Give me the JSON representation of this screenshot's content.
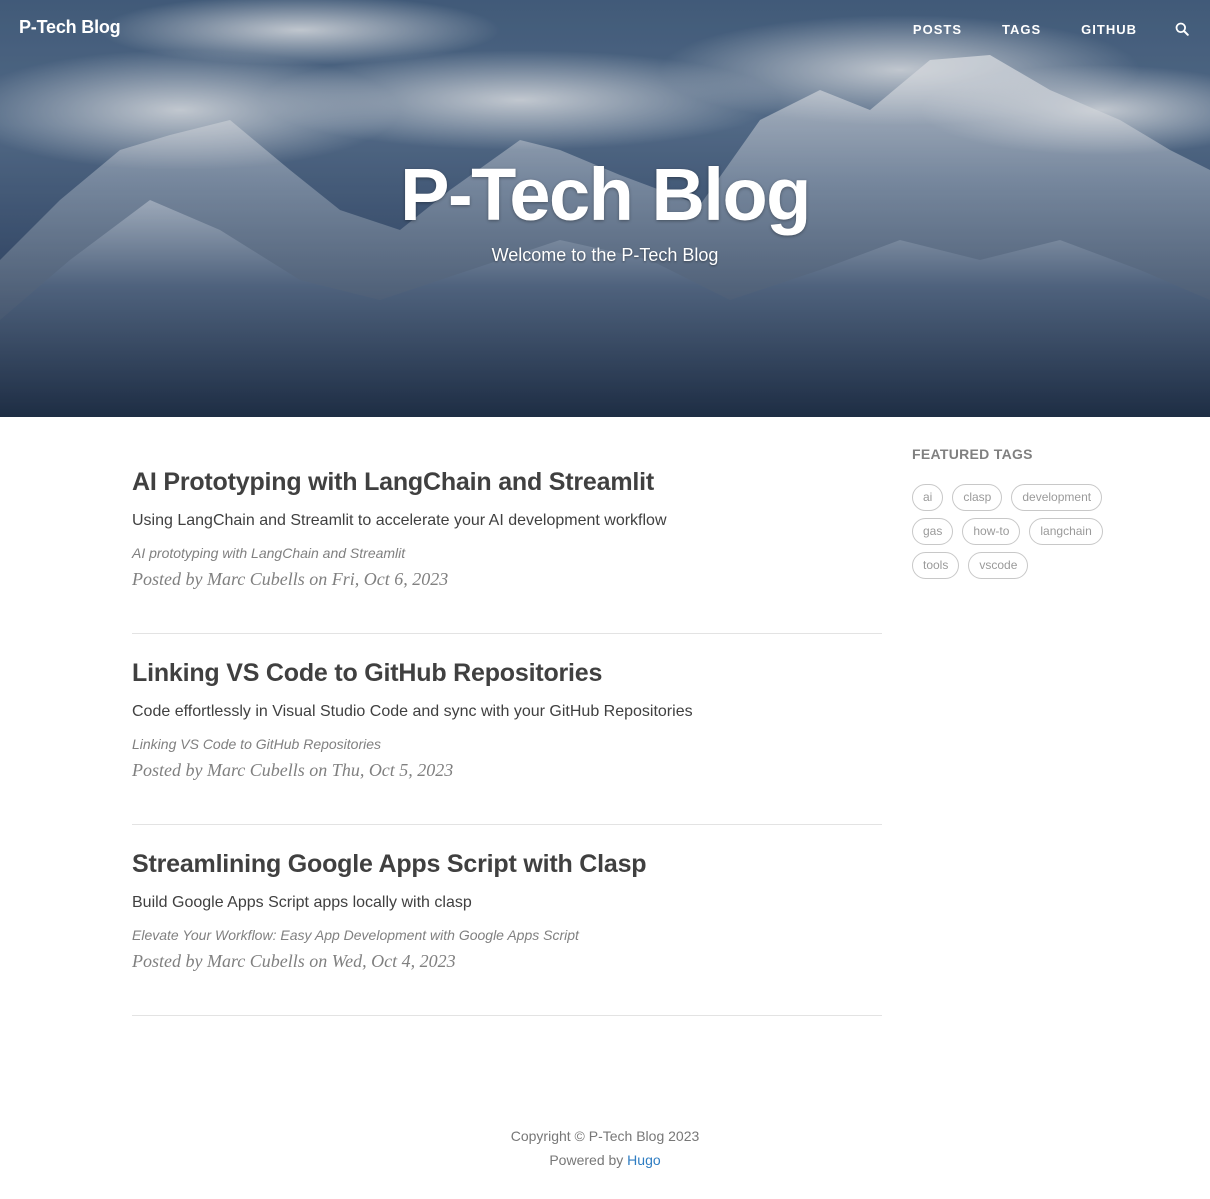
{
  "nav": {
    "brand": "P-Tech Blog",
    "links": [
      "Posts",
      "Tags",
      "GitHub"
    ],
    "search_icon": "search-icon"
  },
  "hero": {
    "title": "P-Tech Blog",
    "subtitle": "Welcome to the P-Tech Blog"
  },
  "posts": [
    {
      "title": "AI Prototyping with LangChain and Streamlit",
      "subtitle": "Using LangChain and Streamlit to accelerate your AI development workflow",
      "preview": "AI prototyping with LangChain and Streamlit",
      "meta": "Posted by Marc Cubells on Fri, Oct 6, 2023"
    },
    {
      "title": "Linking VS Code to GitHub Repositories",
      "subtitle": "Code effortlessly in Visual Studio Code and sync with your GitHub Repositories",
      "preview": "Linking VS Code to GitHub Repositories",
      "meta": "Posted by Marc Cubells on Thu, Oct 5, 2023"
    },
    {
      "title": "Streamlining Google Apps Script with Clasp",
      "subtitle": "Build Google Apps Script apps locally with clasp",
      "preview": "Elevate Your Workflow: Easy App Development with Google Apps Script",
      "meta": "Posted by Marc Cubells on Wed, Oct 4, 2023"
    }
  ],
  "sidebar": {
    "title": "Featured Tags",
    "tags": [
      "ai",
      "clasp",
      "development",
      "gas",
      "how-to",
      "langchain",
      "tools",
      "vscode"
    ]
  },
  "footer": {
    "copyright": "Copyright © P-Tech Blog 2023",
    "powered_prefix": "Powered by",
    "powered_link": "Hugo"
  },
  "colors": {
    "link": "#2f7dc2",
    "text": "#404040",
    "muted": "#808080"
  }
}
